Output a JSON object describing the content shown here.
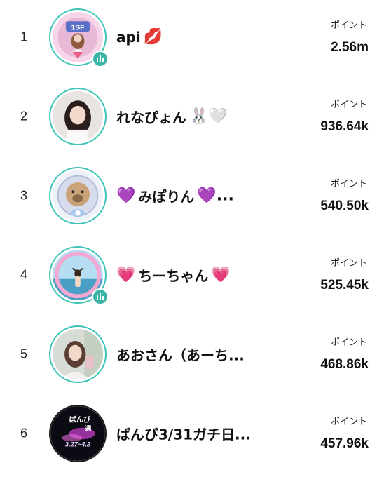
{
  "colors": {
    "ring": "#41c4b8",
    "badge": "#3bb6a6"
  },
  "points_label": "ポイント",
  "entries": [
    {
      "rank": "1",
      "name": "api",
      "name_emoji": "💋",
      "points": "2.56m",
      "live": true
    },
    {
      "rank": "2",
      "name": "れなぴょん",
      "name_emoji": "🐰🤍",
      "points": "936.64k",
      "live": false
    },
    {
      "rank": "3",
      "name_prefix_emoji": "💜",
      "name": "みぽりん",
      "name_emoji": "💜...",
      "points": "540.50k",
      "live": false
    },
    {
      "rank": "4",
      "name_prefix_emoji": "💗",
      "name": "ちーちゃん",
      "name_emoji": "💗",
      "points": "525.45k",
      "live": true
    },
    {
      "rank": "5",
      "name": "あおさん（あーち...",
      "points": "468.86k",
      "live": false
    },
    {
      "rank": "6",
      "name": "ばんび3/31ガチ日...",
      "points": "457.96k",
      "live": false
    }
  ],
  "avatar6_text": {
    "line1": "ばんび",
    "line2": "週",
    "line3": "3.27~4.2"
  }
}
